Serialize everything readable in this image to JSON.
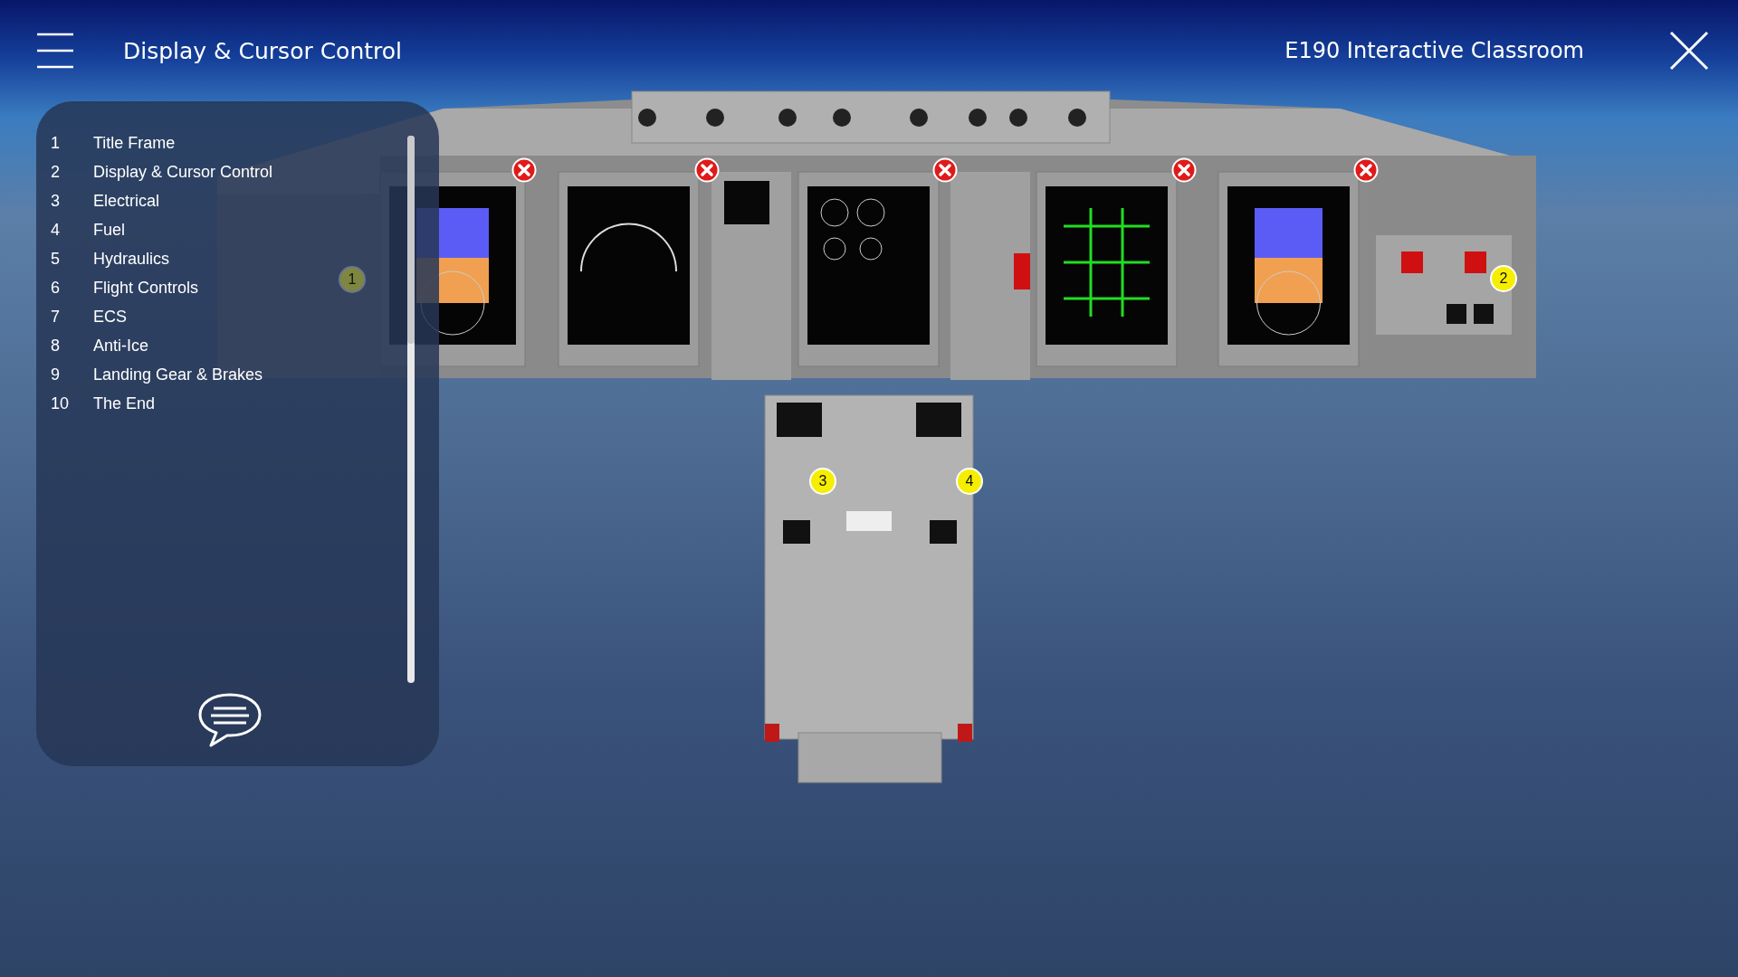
{
  "header": {
    "title": "Display & Cursor Control",
    "course_title": "E190 Interactive Classroom"
  },
  "menu": {
    "items": [
      {
        "number": "1",
        "label": "Title Frame"
      },
      {
        "number": "2",
        "label": "Display & Cursor Control"
      },
      {
        "number": "3",
        "label": "Electrical"
      },
      {
        "number": "4",
        "label": "Fuel"
      },
      {
        "number": "5",
        "label": "Hydraulics"
      },
      {
        "number": "6",
        "label": "Flight Controls"
      },
      {
        "number": "7",
        "label": "ECS"
      },
      {
        "number": "8",
        "label": "Anti-Ice"
      },
      {
        "number": "9",
        "label": "Landing Gear & Brakes"
      },
      {
        "number": "10",
        "label": "The End"
      }
    ]
  },
  "hotspots": [
    {
      "label": "1"
    },
    {
      "label": "2"
    },
    {
      "label": "3"
    },
    {
      "label": "4"
    }
  ]
}
